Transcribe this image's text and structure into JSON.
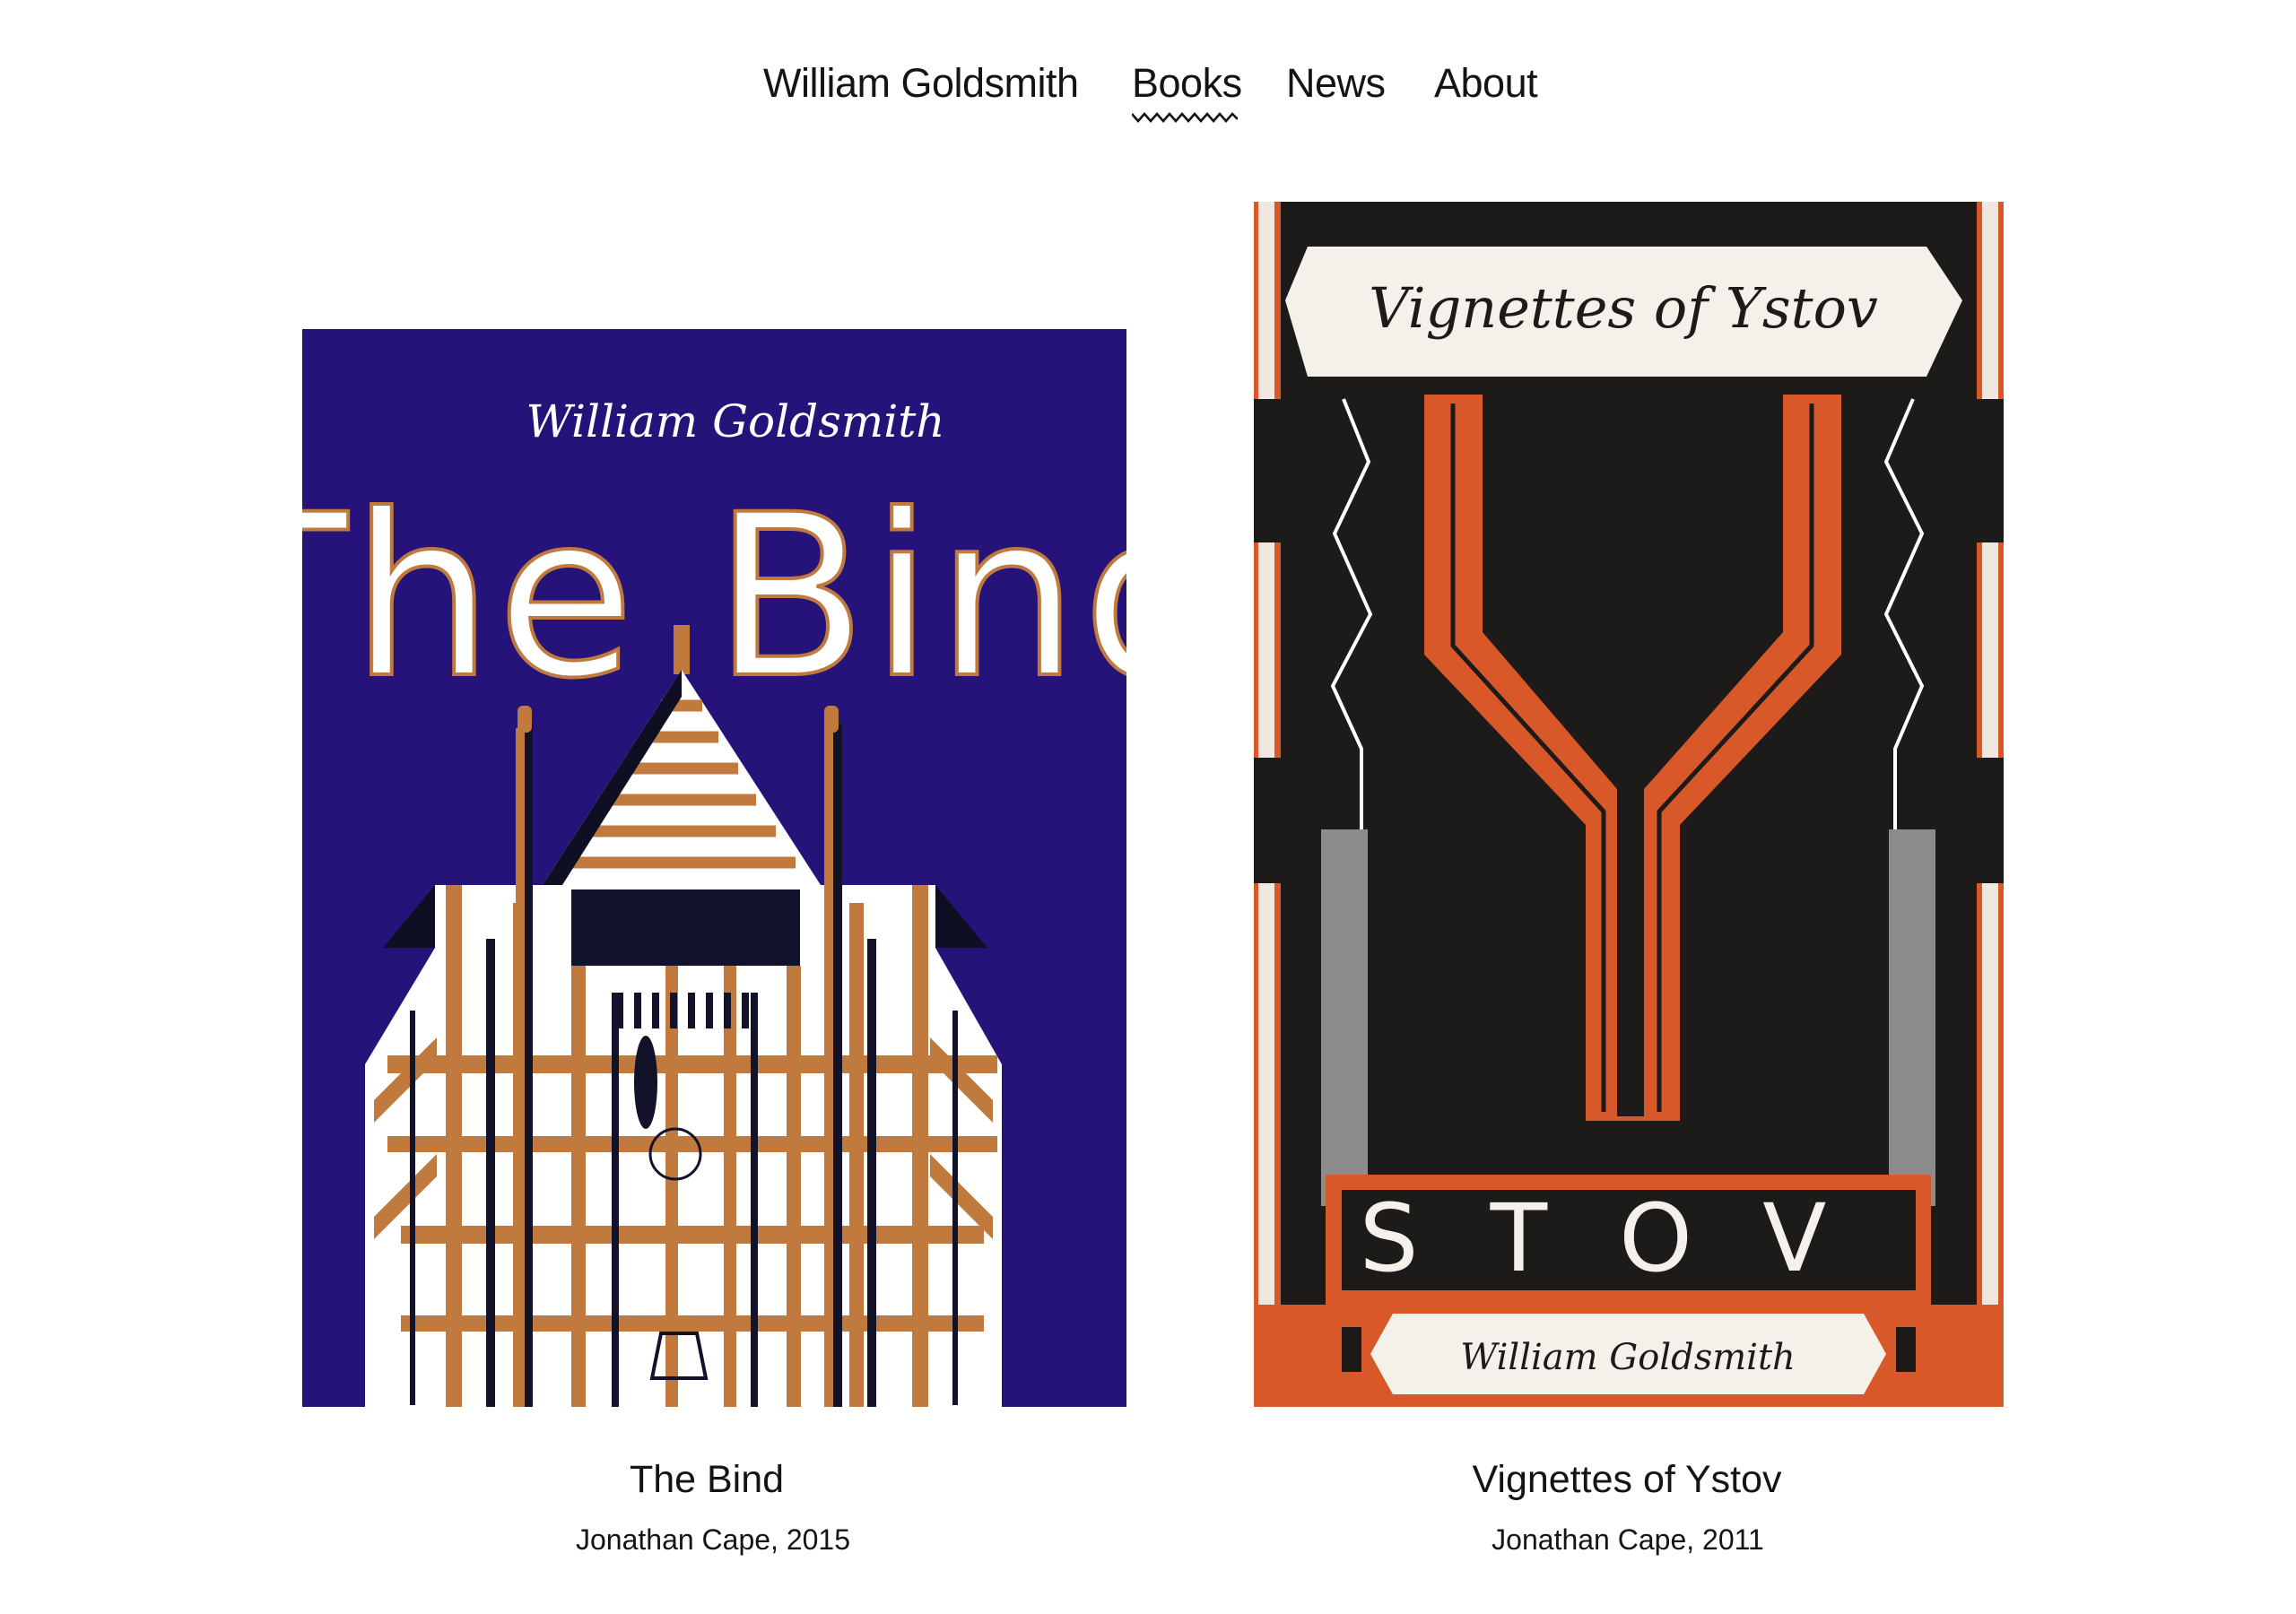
{
  "nav": {
    "home_label": "William Goldsmith",
    "books_label": "Books",
    "news_label": "News",
    "about_label": "About",
    "active": "Books"
  },
  "books": [
    {
      "title": "The Bind",
      "publisher_year": "Jonathan Cape, 2015",
      "cover": {
        "author_text": "William Goldsmith",
        "title_text": "The Bind",
        "background_color": "#26137a",
        "accent_color": "#c07a3e"
      }
    },
    {
      "title": "Vignettes of Ystov",
      "publisher_year": "Jonathan Cape, 2011",
      "cover": {
        "title_text": "Vignettes of Ystov",
        "big_letter": "Y",
        "word_text": "STOV",
        "author_text": "William Goldsmith",
        "background_color": "#1d1a1a",
        "accent_color": "#d9582a"
      }
    }
  ]
}
